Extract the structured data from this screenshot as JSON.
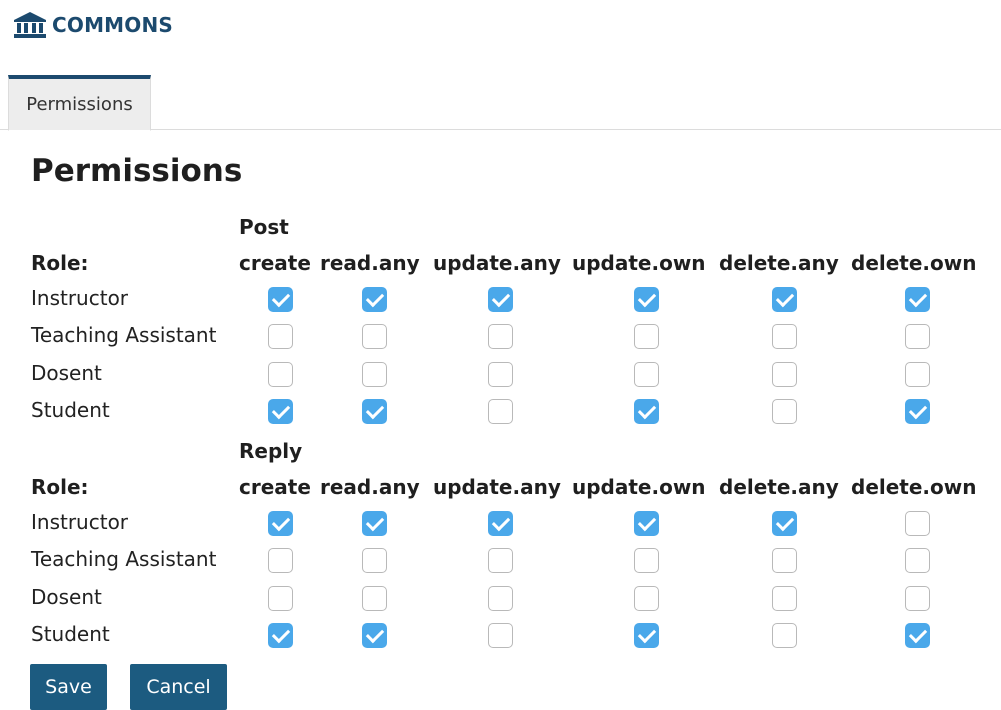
{
  "brand": {
    "name": "COMMONS",
    "icon": "institution-icon",
    "color": "#1c4a6e"
  },
  "tabs": [
    {
      "label": "Permissions",
      "active": true
    }
  ],
  "page": {
    "title": "Permissions"
  },
  "columns": [
    "create",
    "read.any",
    "update.any",
    "update.own",
    "delete.any",
    "delete.own"
  ],
  "role_header": "Role:",
  "sections": [
    {
      "label": "Post",
      "rows": [
        {
          "role": "Instructor",
          "checks": [
            true,
            true,
            true,
            true,
            true,
            true
          ]
        },
        {
          "role": "Teaching Assistant",
          "checks": [
            false,
            false,
            false,
            false,
            false,
            false
          ]
        },
        {
          "role": "Dosent",
          "checks": [
            false,
            false,
            false,
            false,
            false,
            false
          ]
        },
        {
          "role": "Student",
          "checks": [
            true,
            true,
            false,
            true,
            false,
            true
          ]
        }
      ]
    },
    {
      "label": "Reply",
      "rows": [
        {
          "role": "Instructor",
          "checks": [
            true,
            true,
            true,
            true,
            true,
            false
          ]
        },
        {
          "role": "Teaching Assistant",
          "checks": [
            false,
            false,
            false,
            false,
            false,
            false
          ]
        },
        {
          "role": "Dosent",
          "checks": [
            false,
            false,
            false,
            false,
            false,
            false
          ]
        },
        {
          "role": "Student",
          "checks": [
            true,
            true,
            false,
            true,
            false,
            true
          ]
        }
      ]
    }
  ],
  "buttons": {
    "save": "Save",
    "cancel": "Cancel"
  },
  "colors": {
    "accent": "#1c5b80",
    "checked": "#4aa8ea"
  }
}
